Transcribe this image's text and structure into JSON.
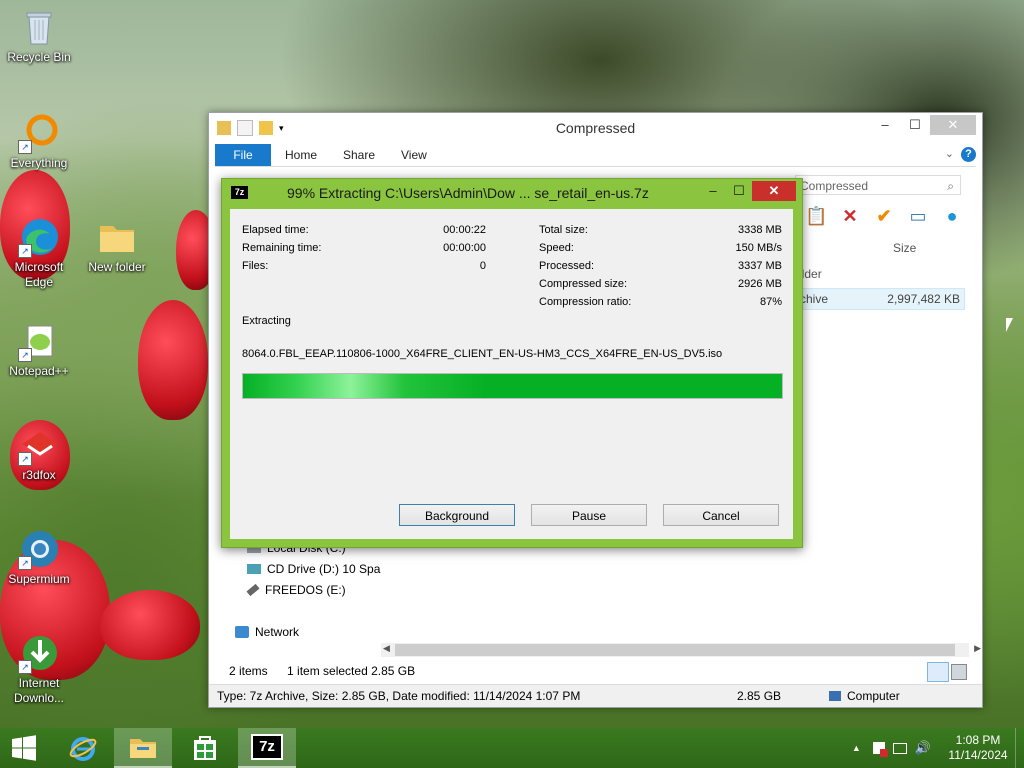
{
  "desktop": {
    "icons": [
      {
        "label": "Recycle Bin"
      },
      {
        "label": "Everything"
      },
      {
        "label": "Microsoft Edge"
      },
      {
        "label": "New folder"
      },
      {
        "label": "Notepad++"
      },
      {
        "label": "r3dfox"
      },
      {
        "label": "Supermium"
      },
      {
        "label": "Internet Downlo..."
      }
    ]
  },
  "explorer": {
    "title": "Compressed",
    "ribbon_tabs": [
      "File",
      "Home",
      "Share",
      "View"
    ],
    "search_placeholder": "Search Compressed",
    "visible_search_text": "Compressed",
    "column_size": "Size",
    "file_rows": [
      {
        "type": "older",
        "size": ""
      },
      {
        "type": "rchive",
        "size": "2,997,482 KB"
      }
    ],
    "nav": {
      "local_disk": "Local Disk (C:)",
      "cd_drive": "CD Drive (D:) 10 Spa",
      "freedos": "FREEDOS (E:)",
      "network": "Network"
    },
    "status": {
      "items": "2 items",
      "selected": "1 item selected  2.85 GB"
    },
    "details": {
      "info": "Type: 7z Archive, Size: 2.85 GB, Date modified: 11/14/2024 1:07 PM",
      "size": "2.85 GB",
      "location": "Computer"
    }
  },
  "dialog": {
    "title": "99% Extracting C:\\Users\\Admin\\Dow ... se_retail_en-us.7z",
    "logo": "7z",
    "left_stats": [
      {
        "label": "Elapsed time:",
        "value": "00:00:22"
      },
      {
        "label": "Remaining time:",
        "value": "00:00:00"
      },
      {
        "label": "Files:",
        "value": "0"
      }
    ],
    "right_stats": [
      {
        "label": "Total size:",
        "value": "3338 MB"
      },
      {
        "label": "Speed:",
        "value": "150 MB/s"
      },
      {
        "label": "Processed:",
        "value": "3337 MB"
      },
      {
        "label": "Compressed size:",
        "value": "2926 MB"
      },
      {
        "label": "Compression ratio:",
        "value": "87%"
      }
    ],
    "status_label": "Extracting",
    "current_file": "8064.0.FBL_EEAP.110806-1000_X64FRE_CLIENT_EN-US-HM3_CCS_X64FRE_EN-US_DV5.iso",
    "progress_fraction": 0.9997,
    "buttons": {
      "background": "Background",
      "pause": "Pause",
      "cancel": "Cancel"
    }
  },
  "taskbar": {
    "clock_time": "1:08 PM",
    "clock_date": "11/14/2024",
    "active_app_label": "7z"
  },
  "colors": {
    "dialog_frame": "#8bc53f",
    "progress_green": "#06b025",
    "taskbar": "#2f6718",
    "ribbon_file": "#1979ca"
  }
}
